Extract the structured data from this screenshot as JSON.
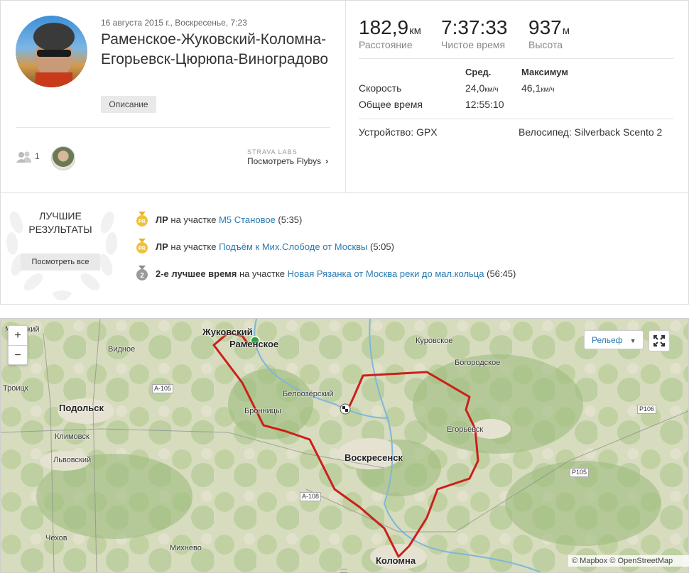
{
  "activity": {
    "date": "16 августа 2015 г., Воскресенье, 7:23",
    "title": "Раменское-Жуковский-Коломна-Егорьевск-Цюрюпа-Виноградово",
    "description_button": "Описание",
    "athletes_count": "1",
    "labs_label": "STRAVA LABS",
    "flybys_label": "Посмотреть Flybys"
  },
  "stats": {
    "distance": {
      "value": "182,9",
      "unit": "км",
      "label": "Расстояние"
    },
    "moving_time": {
      "value": "7:37:33",
      "label": "Чистое время"
    },
    "elevation": {
      "value": "937",
      "unit": "м",
      "label": "Высота"
    },
    "table": {
      "header_avg": "Сред.",
      "header_max": "Максимум",
      "speed_label": "Скорость",
      "speed_avg": "24,0",
      "speed_max": "46,1",
      "speed_unit": "км/ч",
      "elapsed_label": "Общее время",
      "elapsed_value": "12:55:10"
    },
    "device": "Устройство: GPX",
    "bike": "Велосипед: Silverback Scento 2"
  },
  "achievements": {
    "title_line1": "ЛУЧШИЕ",
    "title_line2": "РЕЗУЛЬТАТЫ",
    "see_all": "Посмотреть все",
    "items": [
      {
        "badge": "PR",
        "bold": "ЛР",
        "text": " на участке ",
        "segment": "М5 Становое",
        "time": " (5:35)"
      },
      {
        "badge": "PR",
        "bold": "ЛР",
        "text": " на участке ",
        "segment": "Подъём к Мих.Слободе от Москвы",
        "time": " (5:05)"
      },
      {
        "badge": "2",
        "bold": "2-е лучшее время",
        "text": " на участке ",
        "segment": "Новая Рязанка от Москва реки до мал.кольца",
        "time": " (56:45)"
      }
    ]
  },
  "map": {
    "zoom_in": "+",
    "zoom_out": "−",
    "layer": "Рельеф",
    "attribution": "© Mapbox © OpenStreetMap",
    "labels": {
      "zhukovsky": "Жуковский",
      "ramenskoe": "Раменское",
      "mkovsky": "Мковский",
      "vidnoe": "Видное",
      "troitsk": "Троицк",
      "podolsk": "Подольск",
      "klimovsk": "Климовск",
      "lvovsky": "Львовский",
      "chekhov": "Чехов",
      "mikhnevo": "Михнево",
      "kolomna": "Коломна",
      "voskresensk": "Воскресенск",
      "bronnitsy": "Бронницы",
      "beloozersky": "Белоозёрский",
      "kurovskoe": "Куровское",
      "bogorodskoe": "Богородское",
      "egorievsk": "Егорьевск",
      "a105": "A-105",
      "a108": "A-108",
      "p106": "P106",
      "p105": "P105"
    },
    "colors": {
      "route": "#cc1f1a",
      "start": "#2ba53b",
      "water": "#7fb7d9"
    }
  }
}
